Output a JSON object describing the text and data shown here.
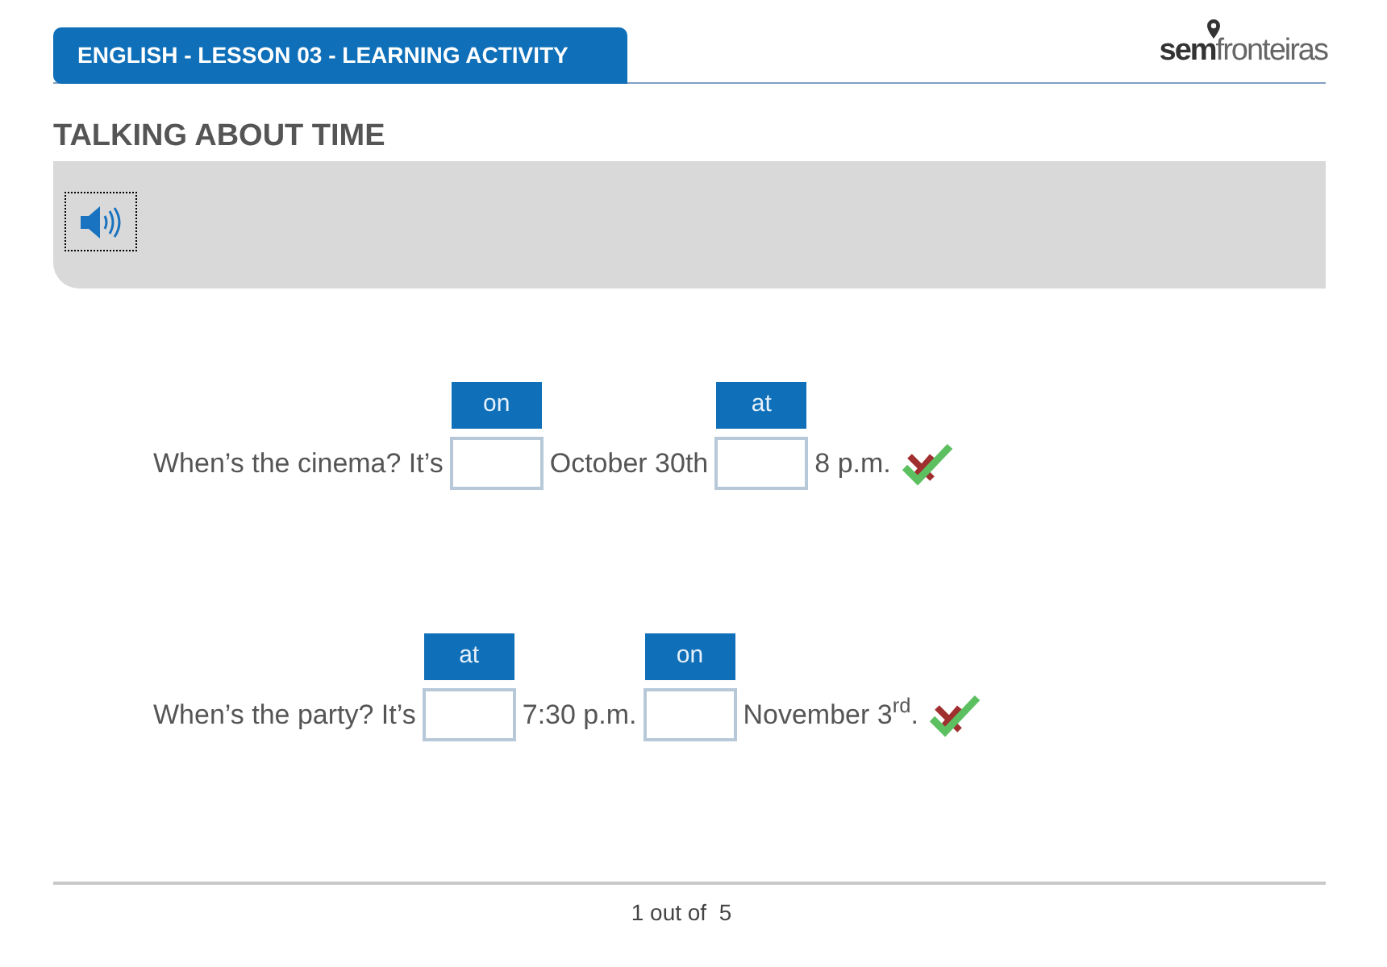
{
  "header": {
    "title": "ENGLISH - LESSON 03 - LEARNING ACTIVITY"
  },
  "logo": {
    "bold_part": "sem",
    "light_part": "fronteiras"
  },
  "activity_title": "TALKING ABOUT TIME",
  "questions": [
    {
      "parts": [
        {
          "kind": "text",
          "text": "When’s the cinema? It’s"
        },
        {
          "kind": "blank",
          "label": "on"
        },
        {
          "kind": "text",
          "text": "October 30th"
        },
        {
          "kind": "blank",
          "label": "at"
        },
        {
          "kind": "text",
          "text": "8 p.m."
        }
      ]
    },
    {
      "parts": [
        {
          "kind": "text",
          "text": "When’s the party? It’s"
        },
        {
          "kind": "blank",
          "label": "at"
        },
        {
          "kind": "text",
          "text": "7:30 p.m."
        },
        {
          "kind": "blank",
          "label": "on"
        },
        {
          "kind": "text",
          "text": "November 3$^{rd}$."
        }
      ]
    }
  ],
  "pager": "1 out of  5"
}
